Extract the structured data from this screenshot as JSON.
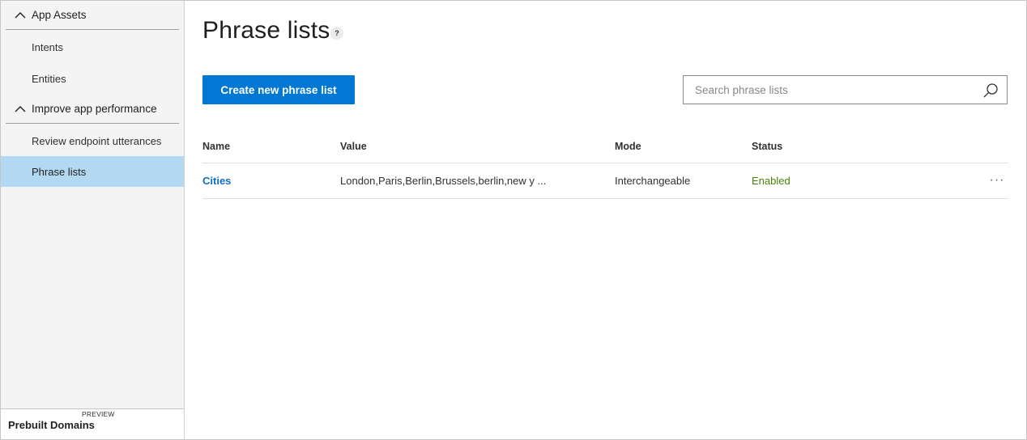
{
  "sidebar": {
    "sections": [
      {
        "label": "App Assets",
        "items": [
          {
            "label": "Intents"
          },
          {
            "label": "Entities"
          }
        ]
      },
      {
        "label": "Improve app performance",
        "items": [
          {
            "label": "Review endpoint utterances"
          },
          {
            "label": "Phrase lists"
          }
        ]
      }
    ],
    "prebuilt": {
      "label": "Prebuilt Domains",
      "badge": "PREVIEW"
    }
  },
  "page": {
    "title": "Phrase lists",
    "help_icon_text": "?"
  },
  "toolbar": {
    "create_label": "Create new phrase list"
  },
  "search": {
    "placeholder": "Search phrase lists",
    "value": ""
  },
  "table": {
    "columns": [
      "Name",
      "Value",
      "Mode",
      "Status"
    ],
    "rows": [
      {
        "name": "Cities",
        "value": "London,Paris,Berlin,Brussels,berlin,new y ...",
        "mode": "Interchangeable",
        "status": "Enabled",
        "more": "···"
      }
    ]
  },
  "colors": {
    "accent": "#0078d4",
    "active_nav": "#b3d9f2",
    "link": "#106ebe",
    "status_enabled": "#498205"
  }
}
